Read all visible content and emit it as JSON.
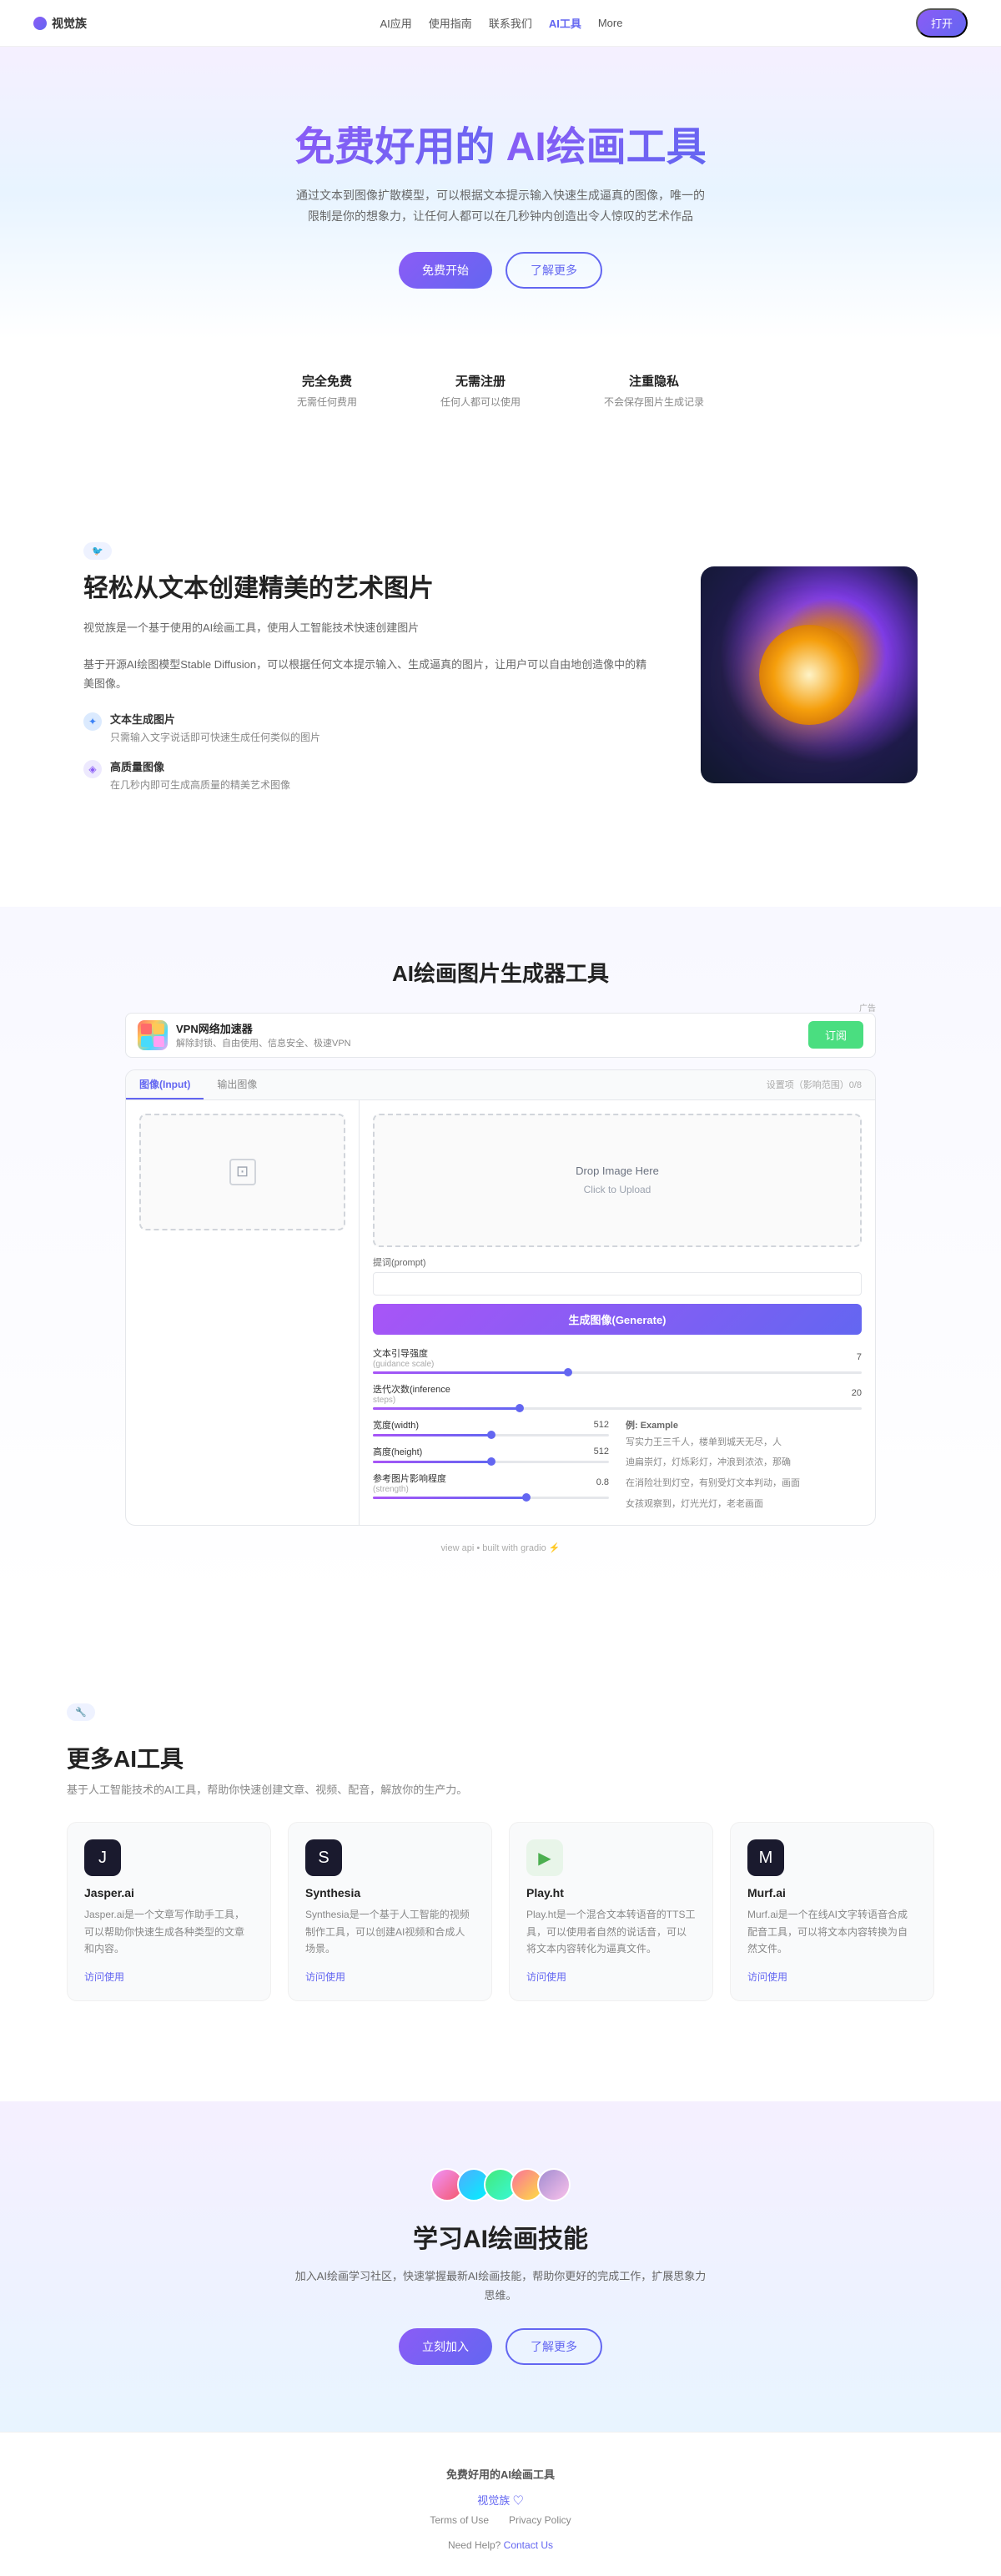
{
  "nav": {
    "logo": "视觉族",
    "links": [
      {
        "label": "AI应用",
        "active": false
      },
      {
        "label": "使用指南",
        "active": false
      },
      {
        "label": "联系我们",
        "active": false
      },
      {
        "label": "AI工具",
        "active": true
      },
      {
        "label": "More",
        "active": false
      }
    ],
    "cta": "打开"
  },
  "hero": {
    "title_prefix": "免费好用的 ",
    "title_highlight": "AI绘画工具",
    "description": "通过文本到图像扩散模型，可以根据文本提示输入快速生成逼真的图像，唯一的限制是你的想象力，让任何人都可以在几秒钟内创造出令人惊叹的艺术作品",
    "btn_primary": "免费开始",
    "btn_secondary": "了解更多"
  },
  "features_row": [
    {
      "title": "完全免费",
      "desc": "无需任何费用"
    },
    {
      "title": "无需注册",
      "desc": "任何人都可以使用"
    },
    {
      "title": "注重隐私",
      "desc": "不会保存图片生成记录"
    }
  ],
  "text_art": {
    "tag": "🐦",
    "heading": "轻松从文本创建精美的艺术图片",
    "desc1": "视觉族是一个基于使用的AI绘画工具，使用人工智能技术快速创建图片",
    "desc2": "基于开源AI绘图模型Stable Diffusion，可以根据任何文本提示输入、生成逼真的图片，让用户可以自由地创造像中的精美图像。",
    "feature1_title": "文本生成图片",
    "feature1_desc": "只需输入文字说话即可快速生成任何类似的图片",
    "feature2_title": "高质量图像",
    "feature2_desc": "在几秒内即可生成高质量的精美艺术图像"
  },
  "ai_tools": {
    "section_title": "AI绘画图片生成器工具",
    "ad": {
      "label": "广告",
      "title": "VPN网络加速器",
      "desc": "解除封锁、自由使用、信息安全、极速VPN",
      "btn": "订阅"
    },
    "widget": {
      "tabs": [
        "图像(Input)",
        "输出图像"
      ],
      "tab_right_label": "设置项（影响范围）0/8",
      "upload_hint": "",
      "drop_title": "Drop Image Here",
      "drop_sub": "Click to Upload",
      "prompt_label": "提词(prompt)",
      "generate_btn": "生成图像(Generate)",
      "params": [
        {
          "name": "文本引导强度",
          "sub": "(guidance scale)",
          "value": "7",
          "fill_pct": 40,
          "thumb_pct": 40
        },
        {
          "name": "迭代次数(inference",
          "sub": "steps)",
          "value": "20",
          "fill_pct": 30,
          "thumb_pct": 30
        },
        {
          "name": "宽度(width)",
          "sub": "",
          "value": "512",
          "fill_pct": 50,
          "thumb_pct": 50
        },
        {
          "name": "高度(height)",
          "sub": "",
          "value": "512",
          "fill_pct": 50,
          "thumb_pct": 50
        },
        {
          "name": "参考图片影响程度",
          "sub": "(strength)",
          "value": "0.8",
          "fill_pct": 65,
          "thumb_pct": 65
        }
      ],
      "example_label": "例: Example",
      "example_texts": [
        "写实力王三千人，楼单到城天无尽，人",
        "迪扁崇灯，灯烁彩灯，冲浪到浓浓，那确",
        "在消险壮到灯空，有别受灯文本判动，画面",
        "女孩观察到，灯光光灯，老老画面"
      ],
      "built_with": "view api • built with gradio ⚡"
    }
  },
  "more_tools": {
    "tag": "🔧",
    "heading": "更多AI工具",
    "desc": "基于人工智能技术的AI工具，帮助你快速创建文章、视频、配音，解放你的生产力。",
    "tools": [
      {
        "name": "Jasper.ai",
        "icon": "J",
        "icon_class": "tool-icon-jasper",
        "desc": "Jasper.ai是一个文章写作助手工具，可以帮助你快速生成各种类型的文章和内容。",
        "link": "访问使用"
      },
      {
        "name": "Synthesia",
        "icon": "S",
        "icon_class": "tool-icon-synthesia",
        "desc": "Synthesia是一个基于人工智能的视频制作工具，可以创建AI视频和合成人场景。",
        "link": "访问使用"
      },
      {
        "name": "Play.ht",
        "icon": "▶",
        "icon_class": "tool-icon-playht",
        "desc": "Play.ht是一个混合文本转语音的TTS工具，可以使用者自然的说话音，可以将文本内容转化为逼真文件。",
        "link": "访问使用"
      },
      {
        "name": "Murf.ai",
        "icon": "M",
        "icon_class": "tool-icon-murf",
        "desc": "Murf.ai是一个在线AI文字转语音合成配音工具，可以将文本内容转换为自然文件。",
        "link": "访问使用"
      }
    ]
  },
  "community": {
    "heading": "学习AI绘画技能",
    "desc": "加入AI绘画学习社区，快速掌握最新AI绘画技能，帮助你更好的完成工作，扩展思象力思维。",
    "btn_primary": "立刻加入",
    "btn_secondary": "了解更多"
  },
  "footer": {
    "brand": "免费好用的AI绘画工具",
    "sub_link": "视觉族 ♡",
    "links": [
      {
        "label": "Terms of Use"
      },
      {
        "label": "Privacy Policy"
      }
    ],
    "contact": "Need Help? Contact Us"
  }
}
